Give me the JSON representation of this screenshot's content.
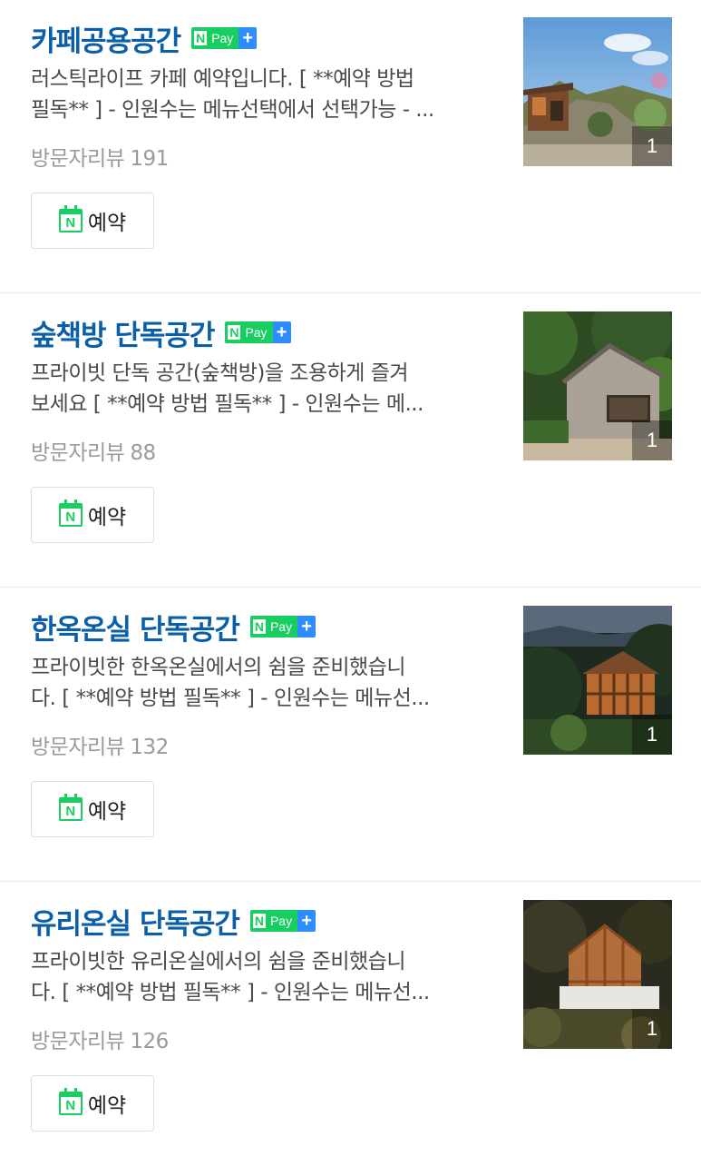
{
  "items": [
    {
      "title": "카페공용공간",
      "npay_label": "Pay",
      "desc_line1": "러스틱라이프 카페 예약입니다. [ **예약 방법",
      "desc_line2": "필독** ] - 인원수는 메뉴선택에서 선택가능 - ...",
      "reviews_label": "방문자리뷰",
      "reviews_count": "191",
      "reserve_label": "예약",
      "photo_count": "1"
    },
    {
      "title": "숲책방 단독공간",
      "npay_label": "Pay",
      "desc_line1": "프라이빗 단독 공간(숲책방)을 조용하게 즐겨",
      "desc_line2": "보세요 [ **예약 방법 필독** ] - 인원수는 메...",
      "reviews_label": "방문자리뷰",
      "reviews_count": "88",
      "reserve_label": "예약",
      "photo_count": "1"
    },
    {
      "title": "한옥온실 단독공간",
      "npay_label": "Pay",
      "desc_line1": "프라이빗한 한옥온실에서의 쉼을 준비했습니",
      "desc_line2": "다. [ **예약 방법 필독** ] - 인원수는 메뉴선...",
      "reviews_label": "방문자리뷰",
      "reviews_count": "132",
      "reserve_label": "예약",
      "photo_count": "1"
    },
    {
      "title": "유리온실 단독공간",
      "npay_label": "Pay",
      "desc_line1": "프라이빗한 유리온실에서의 쉼을 준비했습니",
      "desc_line2": "다. [ **예약 방법 필독** ] - 인원수는 메뉴선...",
      "reviews_label": "방문자리뷰",
      "reviews_count": "126",
      "reserve_label": "예약",
      "photo_count": "1"
    }
  ],
  "colors": {
    "title": "#0a5fa8",
    "naver_green": "#19ce60",
    "npay_plus": "#2d8cff",
    "review_gray": "#9a9a9a"
  },
  "icons": [
    "npay-badge-icon",
    "naver-calendar-icon"
  ]
}
